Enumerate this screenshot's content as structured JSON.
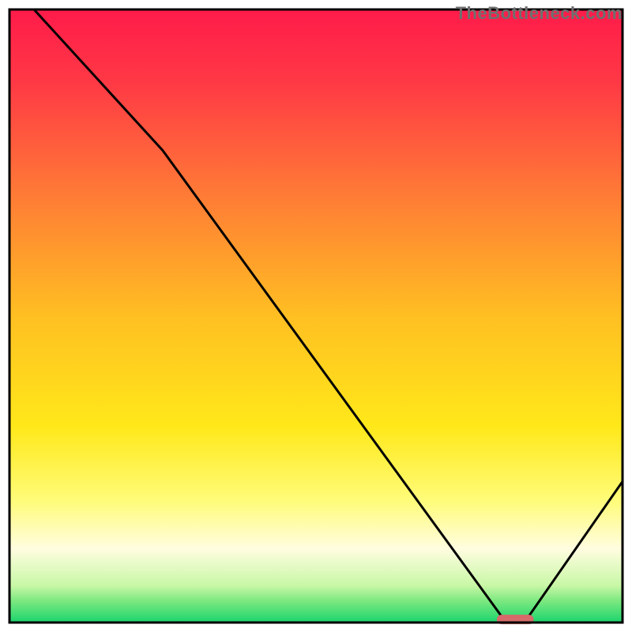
{
  "watermark": "TheBottleneck.com",
  "chart_data": {
    "type": "line",
    "title": "",
    "xlabel": "",
    "ylabel": "",
    "xlim": [
      0,
      100
    ],
    "ylim": [
      0,
      100
    ],
    "curve": {
      "name": "bottleneck-curve",
      "x": [
        4,
        25,
        81,
        84,
        100
      ],
      "y": [
        100,
        77,
        0,
        0,
        23
      ]
    },
    "marker": {
      "name": "optimal-region",
      "x": [
        79.5,
        85.5
      ],
      "y_offset": 0.5
    },
    "gradient_stops": [
      {
        "offset": 0.0,
        "color": "#ff1b4a"
      },
      {
        "offset": 0.12,
        "color": "#ff3945"
      },
      {
        "offset": 0.3,
        "color": "#ff7a36"
      },
      {
        "offset": 0.5,
        "color": "#ffbf22"
      },
      {
        "offset": 0.68,
        "color": "#ffe81a"
      },
      {
        "offset": 0.8,
        "color": "#fffc78"
      },
      {
        "offset": 0.88,
        "color": "#fffde0"
      },
      {
        "offset": 0.94,
        "color": "#c8f7a6"
      },
      {
        "offset": 0.965,
        "color": "#7be87f"
      },
      {
        "offset": 1.0,
        "color": "#1bd46e"
      }
    ],
    "line_color": "#000000",
    "line_width": 3,
    "marker_color": "#d66a6a",
    "frame_color": "#000000",
    "frame_width": 3
  }
}
